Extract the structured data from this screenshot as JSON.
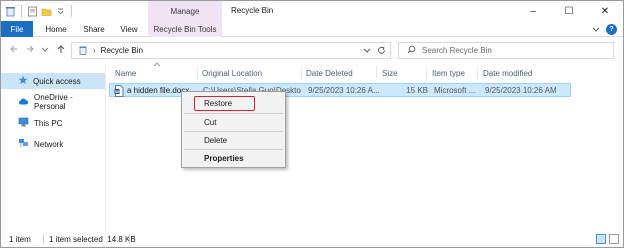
{
  "window": {
    "title": "Recycle Bin",
    "manage_label": "Manage",
    "controls": [
      "–",
      "☐",
      "✕"
    ]
  },
  "ribbon": {
    "tabs": [
      "File",
      "Home",
      "Share",
      "View",
      "Recycle Bin Tools"
    ],
    "help": "?"
  },
  "address": {
    "path": "Recycle Bin",
    "search_placeholder": "Search Recycle Bin"
  },
  "sidebar": {
    "items": [
      {
        "label": "Quick access",
        "icon": "star-icon",
        "active": true
      },
      {
        "label": "OneDrive - Personal",
        "icon": "cloud-icon",
        "active": false
      },
      {
        "label": "This PC",
        "icon": "computer-icon",
        "active": false
      },
      {
        "label": "Network",
        "icon": "network-icon",
        "active": false
      }
    ]
  },
  "columns": [
    "Name",
    "Original Location",
    "Date Deleted",
    "Size",
    "Item type",
    "Date modified"
  ],
  "files": [
    {
      "name": "a hidden file.docx",
      "original_location": "C:\\Users\\Stella Guo\\Desktop",
      "date_deleted": "9/25/2023 10:26 A...",
      "size": "15 KB",
      "item_type": "Microsoft ...",
      "date_modified": "9/25/2023 10:26 AM"
    }
  ],
  "context_menu": {
    "items": [
      "Restore",
      "Cut",
      "Delete",
      "Properties"
    ],
    "highlight_color": "#d9232e"
  },
  "status": {
    "count": "1 item",
    "selected": "1 item selected  14.8 KB"
  },
  "colors": {
    "accent": "#1a6fc4",
    "tools_tab": "#f0e3f3",
    "selection": "#cce8ff"
  }
}
